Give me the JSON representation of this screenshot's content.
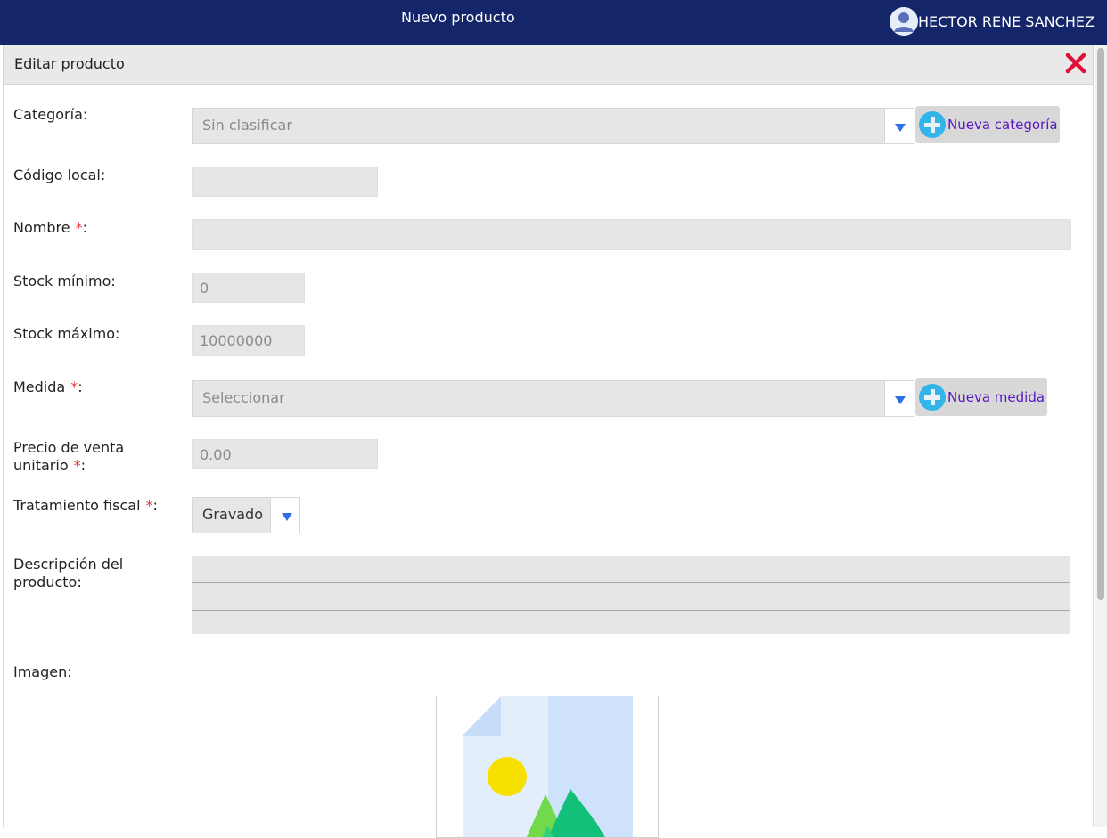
{
  "topbar": {
    "title": "Nuevo producto",
    "user_name": "HECTOR RENE SANCHEZ",
    "bg_color": "#142569"
  },
  "modal": {
    "title": "Editar producto",
    "close_icon": "close-x-icon"
  },
  "form": {
    "categoria": {
      "label": "Categoría:",
      "value": "Sin clasificar",
      "add_label": "Nueva categoría"
    },
    "codigo_local": {
      "label": "Código local:",
      "value": ""
    },
    "nombre": {
      "label": "Nombre",
      "required": "*",
      "colon": ":",
      "value": ""
    },
    "stock_minimo": {
      "label": "Stock mínimo:",
      "value": "0"
    },
    "stock_maximo": {
      "label": "Stock máximo:",
      "value": "10000000"
    },
    "medida": {
      "label": "Medida",
      "required": "*",
      "colon": ":",
      "value": "Seleccionar",
      "add_label": "Nueva medida"
    },
    "precio": {
      "label_line1": "Precio de venta",
      "label_line2": "unitario",
      "required": "*",
      "colon": ":",
      "value": "0.00"
    },
    "tratamiento": {
      "label": "Tratamiento fiscal",
      "required": "*",
      "colon": ":",
      "value": "Gravado"
    },
    "descripcion": {
      "label_line1": "Descripción del",
      "label_line2": "producto:",
      "value": ""
    },
    "imagen": {
      "label": "Imagen:",
      "placeholder_icon": "image-placeholder-icon"
    }
  },
  "colors": {
    "accent": "#2f6ee8",
    "add_button_text": "#5a16c4",
    "required": "#e23a3a",
    "close": "#e0103a"
  }
}
